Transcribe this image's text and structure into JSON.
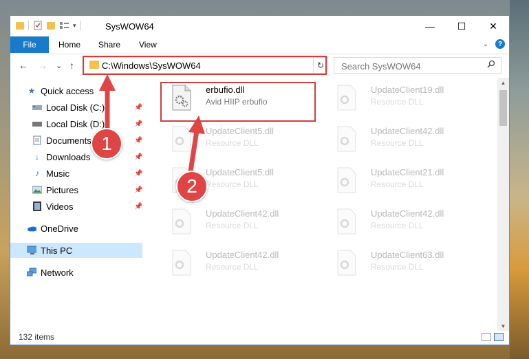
{
  "window": {
    "title": "SysWOW64",
    "minimize": "—",
    "maximize": "☐",
    "close": "✕"
  },
  "ribbon": {
    "tabs": [
      "File",
      "Home",
      "Share",
      "View"
    ],
    "help": "?"
  },
  "nav": {
    "back": "←",
    "forward": "→",
    "recent": "⌄",
    "up": "↑",
    "address": "C:\\Windows\\SysWOW64",
    "refresh": "↻",
    "search_placeholder": "Search SysWOW64"
  },
  "sidebar": {
    "items": [
      {
        "label": "Quick access",
        "icon": "star-icon",
        "pinned": false
      },
      {
        "label": "Local Disk (C:)",
        "icon": "drive-icon",
        "pinned": true
      },
      {
        "label": "Local Disk (D:)",
        "icon": "drive-icon",
        "pinned": true
      },
      {
        "label": "Documents",
        "icon": "documents-icon",
        "pinned": true
      },
      {
        "label": "Downloads",
        "icon": "downloads-icon",
        "pinned": true
      },
      {
        "label": "Music",
        "icon": "music-icon",
        "pinned": true
      },
      {
        "label": "Pictures",
        "icon": "pictures-icon",
        "pinned": true
      },
      {
        "label": "Videos",
        "icon": "videos-icon",
        "pinned": true
      },
      {
        "label": "OneDrive",
        "icon": "onedrive-icon",
        "pinned": false
      },
      {
        "label": "This PC",
        "icon": "computer-icon",
        "pinned": false,
        "selected": true
      },
      {
        "label": "Network",
        "icon": "network-icon",
        "pinned": false
      }
    ]
  },
  "files": [
    {
      "name": "erbufio.dll",
      "desc": "Avid HIIP erbufio",
      "highlighted": true
    },
    {
      "name": "UpdateClient19.dll",
      "desc": "Resource DLL"
    },
    {
      "name": "UpdateClient5.dll",
      "desc": "Resource DLL"
    },
    {
      "name": "UpdateClient42.dll",
      "desc": "Resource DLL"
    },
    {
      "name": "UpdateClient5.dll",
      "desc": "Resource DLL"
    },
    {
      "name": "UpdateClient21.dll",
      "desc": "Resource DLL"
    },
    {
      "name": "UpdateClient42.dll",
      "desc": "Resource DLL"
    },
    {
      "name": "UpdateClient42.dll",
      "desc": "Resource DLL"
    },
    {
      "name": "UpdateClient42.dll",
      "desc": "Resource DLL"
    },
    {
      "name": "UpdateClient63.dll",
      "desc": "Resource DLL"
    }
  ],
  "status": {
    "item_count": "132 items"
  },
  "annotations": {
    "marker1": "1",
    "marker2": "2",
    "color": "#e04545"
  }
}
